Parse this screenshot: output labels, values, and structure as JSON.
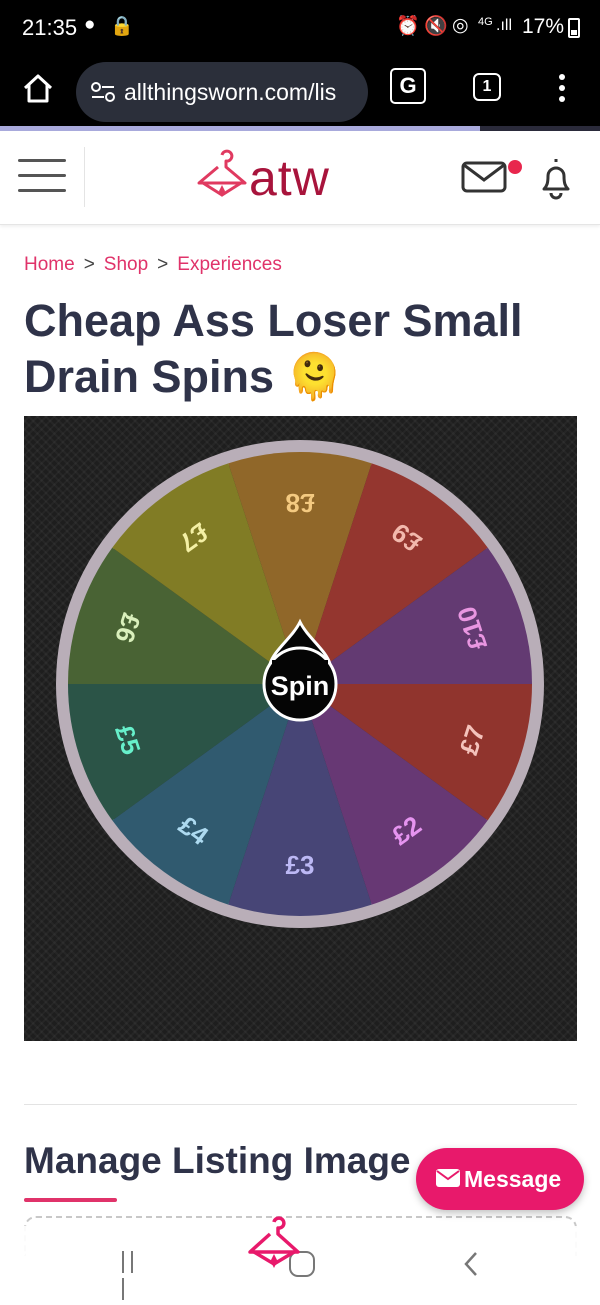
{
  "status_bar": {
    "time": "21:35",
    "battery": "17%",
    "network": "4G"
  },
  "browser": {
    "url": "allthingsworn.com/lis",
    "tab_count": "1",
    "page_load_progress": 0.8
  },
  "header": {
    "logo_text": "atw",
    "has_unread_messages": true
  },
  "breadcrumb": [
    "Home",
    "Shop",
    "Experiences"
  ],
  "page_title": "Cheap Ass Loser Small Drain Spins 🫠",
  "wheel": {
    "center_label": "Spin",
    "slices": [
      {
        "label": "£8",
        "color": "#8a5e1c"
      },
      {
        "label": "£9",
        "color": "#8e2a22"
      },
      {
        "label": "£10",
        "color": "#5a2e6a"
      },
      {
        "label": "£7",
        "color": "#8a2820"
      },
      {
        "label": "£2",
        "color": "#5e2c6c"
      },
      {
        "label": "£3",
        "color": "#3c3a6e"
      },
      {
        "label": "£4",
        "color": "#245066"
      },
      {
        "label": "£5",
        "color": "#1e4a3c"
      },
      {
        "label": "£6",
        "color": "#3e5a28"
      },
      {
        "label": "£7",
        "color": "#7a7418"
      }
    ],
    "label_colors": {
      "£8": "#f4c77a",
      "£9": "#f2b5a8",
      "£10": "#e890e0",
      "£7": "#f4c0b8",
      "£2": "#e58ef0",
      "£3": "#b8b4f4",
      "£4": "#a8d8f0",
      "£5": "#5ef0c8",
      "£6": "#d8f0b8",
      "£7b": "#f4f0a0"
    }
  },
  "section": {
    "title": "Manage Listing Image"
  },
  "message_button": {
    "label": "Message"
  },
  "colors": {
    "brand": "#a8143c",
    "accent": "#e8196b",
    "link": "#e0336a",
    "title": "#2f3349"
  }
}
